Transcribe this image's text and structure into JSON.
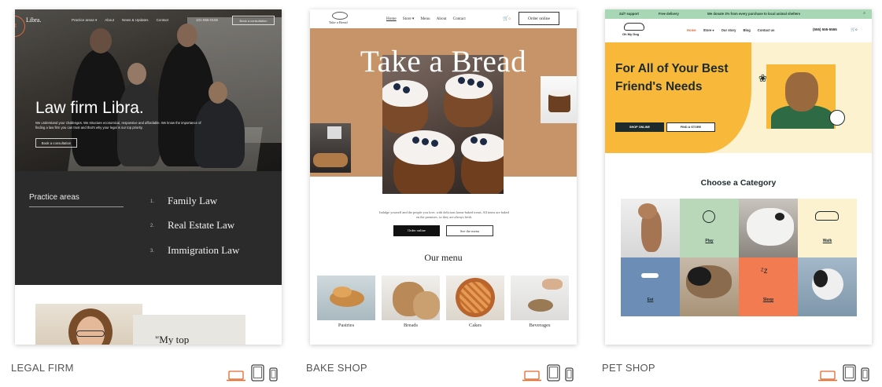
{
  "templates": [
    {
      "caption": "LEGAL FIRM",
      "site": {
        "logo": "Libra.",
        "nav": [
          "Practice areas ▾",
          "About",
          "News & Updates",
          "Contact"
        ],
        "phone": "101-555-0155",
        "book_button": "Book a consultation",
        "hero_title": "Law firm Libra.",
        "hero_text": "We understand your challenges. We structure economical, responsive and affordable. We know the importance of finding a law firm you can trust and that's why your legal is our top priority.",
        "hero_cta": "Book a consultation",
        "practice_heading": "Practice areas",
        "practice_items": [
          {
            "num": "1.",
            "label": "Family Law"
          },
          {
            "num": "2.",
            "label": "Real Estate Law"
          },
          {
            "num": "3.",
            "label": "Immigration Law"
          }
        ],
        "quote_text": "\"My top"
      }
    },
    {
      "caption": "BAKE SHOP",
      "site": {
        "logo": "Take a Bread",
        "nav": [
          "Home",
          "Store ▾",
          "Menu",
          "About",
          "Contact"
        ],
        "order_button": "Order online",
        "cart_count": "0",
        "hero_title": "Take a Bread",
        "intro_text": "Indulge yourself and the people you love, with delicious home-baked treats. All items are baked on the premises, so they are always fresh.",
        "btn_order": "Order online",
        "btn_menu": "See the menu",
        "menu_title": "Our menu",
        "products": [
          "Pastries",
          "Breads",
          "Cakes",
          "Beverages"
        ]
      }
    },
    {
      "caption": "PET SHOP",
      "site": {
        "topbar_support": "24/7 support",
        "topbar_delivery": "Free delivery",
        "topbar_donate": "We donate 3% from every purchase to local animal shelters",
        "logo": "Oh My Dog",
        "nav": [
          "Home",
          "Store ▾",
          "Our story",
          "Blog",
          "Contact us"
        ],
        "phone": "(555) 555-5555",
        "cart_count": "0",
        "hero_title": "For All of Your Best Friend's Needs",
        "btn_shop": "SHOP ONLINE",
        "btn_store": "FIND A STORE",
        "category_title": "Choose a Category",
        "categories": [
          "Play",
          "Walk",
          "Eat",
          "Sleep"
        ]
      }
    }
  ],
  "colors": {
    "device_icon_active": "#e1692d",
    "device_icon": "#444444",
    "bake_tan": "#c7946a",
    "pet_yellow": "#f8b93a",
    "pet_green": "#a7d7b4"
  },
  "device_icons": [
    "desktop-icon",
    "tablet-icon",
    "mobile-icon"
  ]
}
